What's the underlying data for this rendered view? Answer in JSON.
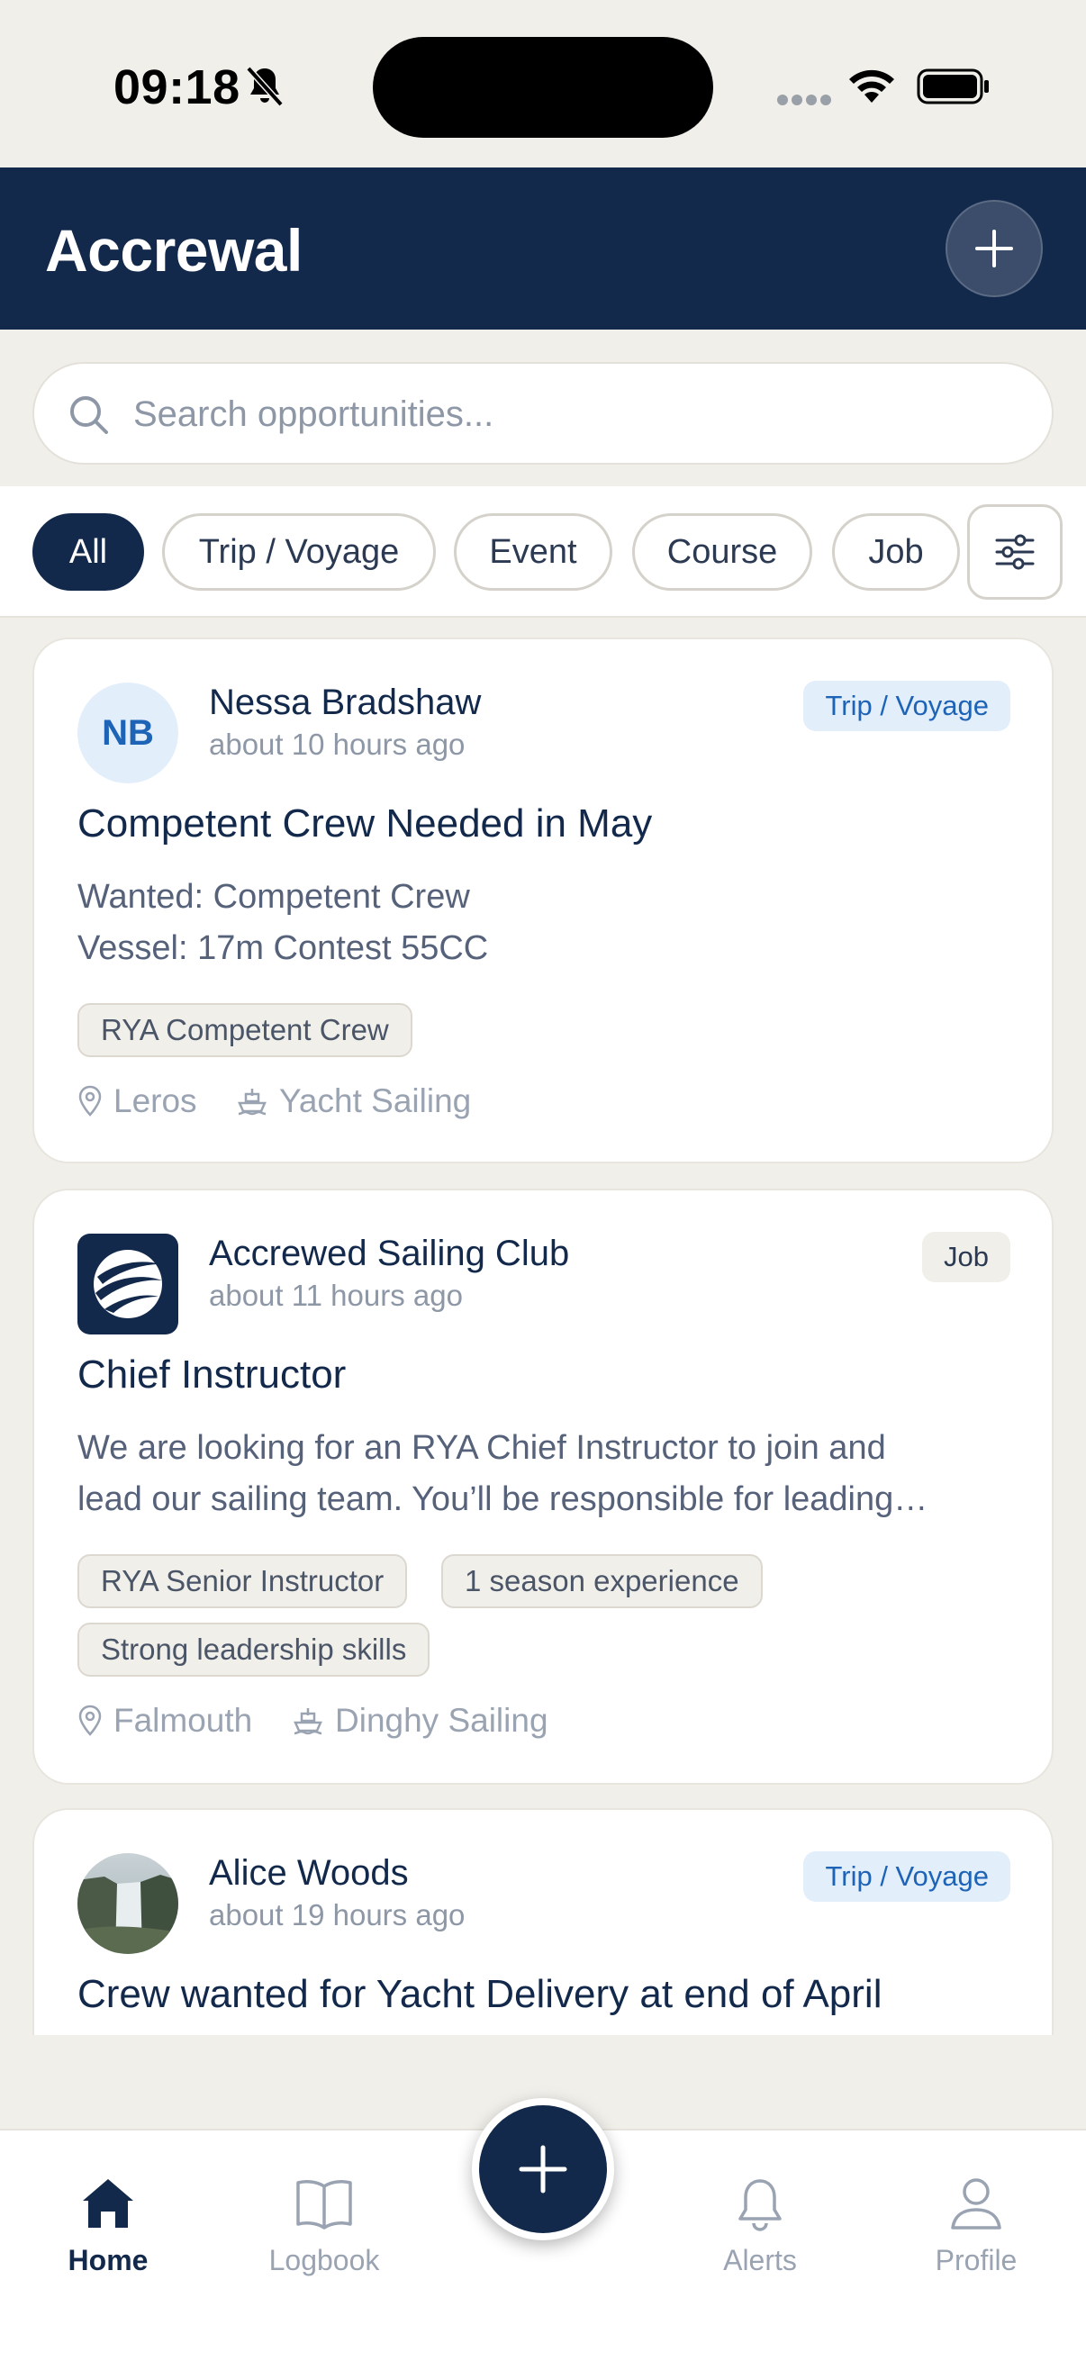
{
  "status_bar": {
    "time": "09:18"
  },
  "header": {
    "title": "Accrewal"
  },
  "search": {
    "placeholder": "Search opportunities..."
  },
  "filters": {
    "chips": [
      "All",
      "Trip / Voyage",
      "Event",
      "Course",
      "Job"
    ],
    "active": "All"
  },
  "posts": [
    {
      "avatar_initials": "NB",
      "poster": "Nessa Bradshaw",
      "time": "about 10 hours ago",
      "type": "Trip / Voyage",
      "title": "Competent Crew Needed in May",
      "body": [
        "Wanted: Competent Crew",
        "Vessel: 17m Contest 55CC"
      ],
      "tags": [
        "RYA Competent Crew"
      ],
      "location": "Leros",
      "activity": "Yacht Sailing"
    },
    {
      "poster": "Accrewed Sailing Club",
      "time": "about 11 hours ago",
      "type": "Job",
      "title": "Chief Instructor",
      "body": [
        "We are looking for an RYA Chief Instructor to join and",
        "lead our sailing team. You’ll be responsible for leading…"
      ],
      "tags": [
        "RYA Senior Instructor",
        "1 season experience",
        "Strong leadership skills"
      ],
      "location": "Falmouth",
      "activity": "Dinghy Sailing"
    },
    {
      "poster": "Alice Woods",
      "time": "about 19 hours ago",
      "type": "Trip / Voyage",
      "title": "Crew wanted for Yacht Delivery at end of April"
    }
  ],
  "nav": {
    "items": [
      "Home",
      "Logbook",
      "Alerts",
      "Profile"
    ],
    "active": "Home"
  },
  "colors": {
    "navy": "#13294b",
    "badge_blue": "#1d63b6",
    "background": "#f1efea"
  }
}
